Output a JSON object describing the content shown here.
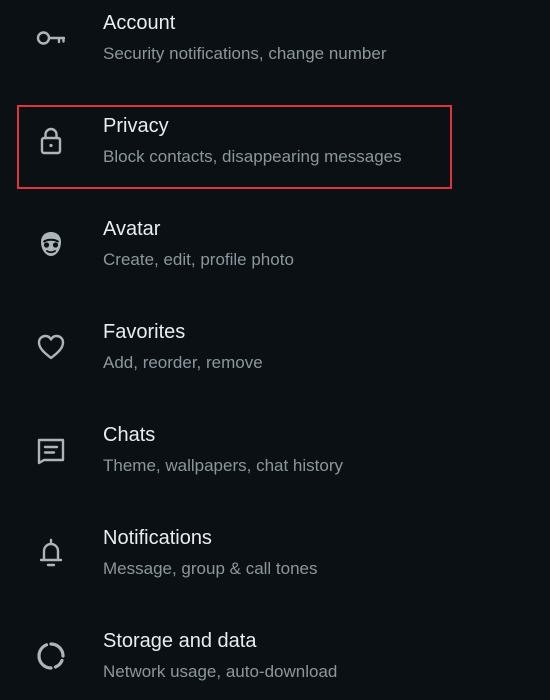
{
  "settings": {
    "items": [
      {
        "key": "account",
        "icon": "key-icon",
        "title": "Account",
        "subtitle": "Security notifications, change number"
      },
      {
        "key": "privacy",
        "icon": "lock-icon",
        "title": "Privacy",
        "subtitle": "Block contacts, disappearing messages"
      },
      {
        "key": "avatar",
        "icon": "avatar-face-icon",
        "title": "Avatar",
        "subtitle": "Create, edit, profile photo"
      },
      {
        "key": "favorites",
        "icon": "heart-icon",
        "title": "Favorites",
        "subtitle": "Add, reorder, remove"
      },
      {
        "key": "chats",
        "icon": "chat-icon",
        "title": "Chats",
        "subtitle": "Theme, wallpapers, chat history"
      },
      {
        "key": "notifications",
        "icon": "bell-icon",
        "title": "Notifications",
        "subtitle": "Message, group & call tones"
      },
      {
        "key": "storage",
        "icon": "storage-ring-icon",
        "title": "Storage and data",
        "subtitle": "Network usage, auto-download"
      }
    ]
  },
  "highlight": {
    "target": "privacy",
    "color": "#e0343c"
  },
  "colors": {
    "background": "#0b1014",
    "title_text": "#e9edef",
    "subtitle_text": "#8d969b",
    "icon": "#aeb5b9"
  }
}
